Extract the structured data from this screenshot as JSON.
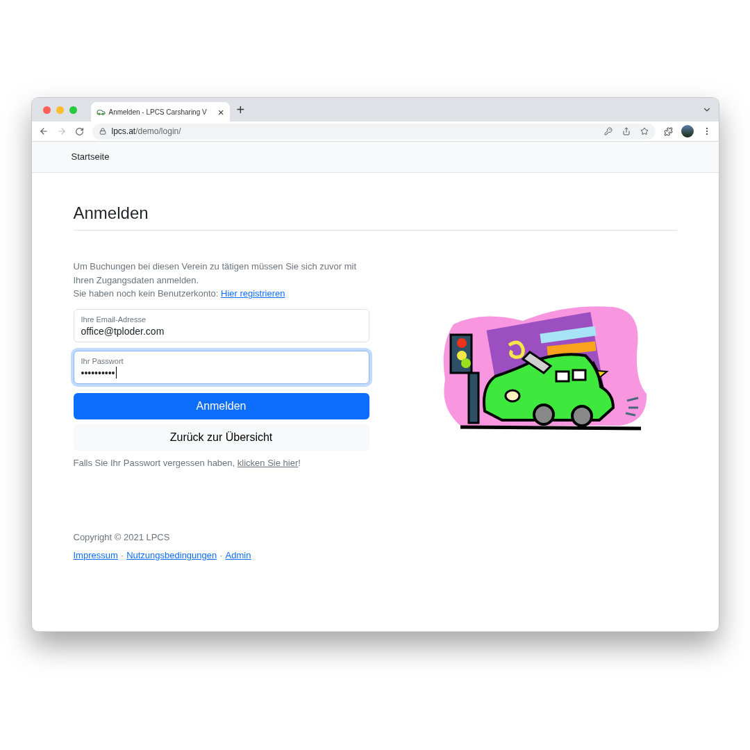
{
  "browser": {
    "tab": {
      "title": "Anmelden - LPCS Carsharing V",
      "close": "×"
    },
    "new_tab": "+",
    "url": {
      "host": "lpcs.at",
      "path": "/demo/login/"
    }
  },
  "navbar": {
    "brand": "Startseite"
  },
  "page": {
    "title": "Anmelden",
    "intro": {
      "line1": "Um Buchungen bei diesen Verein zu tätigen müssen Sie sich zuvor mit Ihren Zugangsdaten anmelden.",
      "line2": "Sie haben noch kein Benutzerkonto:",
      "link": "Hier registrieren"
    },
    "fields": [
      {
        "label": "Ihre Email-Adresse",
        "value": "office@tploder.com",
        "focused": false
      },
      {
        "label": "Ihr Passwort",
        "value": "••••••••••",
        "focused": true
      }
    ],
    "buttons": [
      {
        "label": "Anmelden",
        "kind": "primary"
      },
      {
        "label": "Zurück zur Übersicht",
        "kind": "light"
      }
    ],
    "forgot": {
      "text": "Falls Sie Ihr Passwort vergessen haben,",
      "link": "klicken Sie hier",
      "end": "!"
    }
  },
  "footer": {
    "copyright": "Copyright © 2021 LPCS",
    "links": [
      "Impressum",
      "Nutzungsbedingungen",
      "Admin"
    ],
    "separator": "·"
  }
}
